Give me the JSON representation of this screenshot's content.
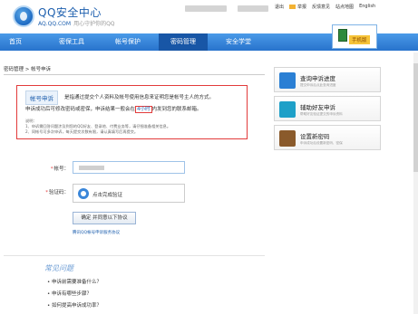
{
  "header": {
    "brand": "QQ安全中心",
    "domain": "AQ.QQ.COM",
    "slogan": "用心守护你的QQ",
    "top_links": [
      "退出",
      "举报",
      "反馈意见",
      "站点地图",
      "English"
    ]
  },
  "nav": {
    "items": [
      "首页",
      "密保工具",
      "帐号保护",
      "密码管理",
      "安全学堂"
    ],
    "active_index": 3,
    "notice_label": "手机版"
  },
  "breadcrumb": "密码管理 > 帐号申诉",
  "info": {
    "tag": "帐号申诉",
    "line1": "是指通过提交个人资料及帐号使用信息来证明您是帐号主人的方式。",
    "line2_prefix": "申诉成功后可修改密码或密保，申诉结果一般会在",
    "line2_highlight": "4小时",
    "line2_suffix": "内发到您的联系邮箱。",
    "note_title": "说明：",
    "note_1": "1、申诉需回答问题涉及到您的QQ好友、登录地、付费业务等，请仔细准备相关信息。",
    "note_2": "2、同帐号可多次申诉，每天提交次数有限，请认真填写后再提交。"
  },
  "form": {
    "account_label": "帐号：",
    "verify_label": "验证码：",
    "verify_hint": "点击完成验证",
    "confirm_button": "确定 并同意以下协议",
    "agreement_link": "腾讯QQ帐号申诉服务协议"
  },
  "faq": {
    "title": "常见问题",
    "items": [
      "• 申诉前需要准备什么？",
      "• 申诉有哪些步骤？",
      "• 如何提高申诉成功率？"
    ]
  },
  "sidebar": {
    "cards": [
      {
        "title": "查询申诉进度",
        "sub": "提交申诉后点此查询进度",
        "icon": "search-icon",
        "color": "#2a7fd4"
      },
      {
        "title": "辅助好友申诉",
        "sub": "帮助好友验证提交的申诉资料",
        "icon": "friend-icon",
        "color": "#1ea0c8"
      },
      {
        "title": "设置新密码",
        "sub": "申诉成功后设置新密码、密保",
        "icon": "password-icon",
        "color": "#8a5a2b"
      }
    ]
  }
}
